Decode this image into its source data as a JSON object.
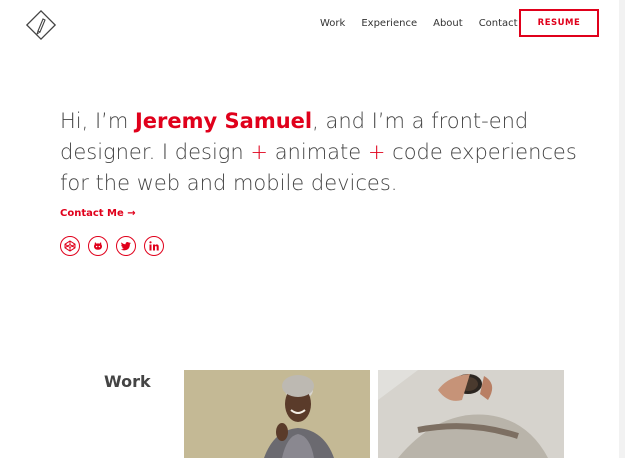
{
  "header": {
    "logo_icon": "diamond-pen-logo-icon",
    "nav": [
      {
        "label": "Work"
      },
      {
        "label": "Experience"
      },
      {
        "label": "About"
      },
      {
        "label": "Contact"
      }
    ],
    "resume_label": "RESUME"
  },
  "hero": {
    "intro_prefix": "Hi, I’m ",
    "name": "Jeremy Samuel",
    "intro_mid": ", and I’m a front-end designer. I design ",
    "plus1": "+",
    "word_animate": " animate ",
    "plus2": "+",
    "intro_end": " code experiences for the web and mobile devices."
  },
  "contact_link": "Contact Me →",
  "socials": [
    {
      "icon": "codepen-icon"
    },
    {
      "icon": "github-icon"
    },
    {
      "icon": "twitter-icon"
    },
    {
      "icon": "linkedin-icon"
    }
  ],
  "work": {
    "title": "Work"
  },
  "colors": {
    "accent": "#e0001b",
    "text": "#444444"
  }
}
